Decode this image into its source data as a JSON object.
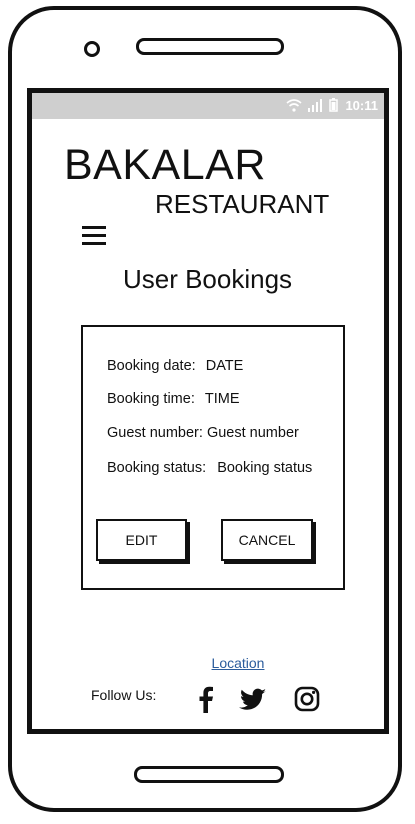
{
  "status_bar": {
    "time": "10:11",
    "icons": [
      "wifi-icon",
      "signal-icon",
      "battery-icon"
    ]
  },
  "header": {
    "brand_main": "BAKALAR",
    "brand_sub": "RESTAURANT",
    "menu_icon": "hamburger-menu-icon"
  },
  "page": {
    "title": "User Bookings"
  },
  "booking": {
    "date_label": "Booking date:",
    "date_value": "DATE",
    "time_label": "Booking time:",
    "time_value": "TIME",
    "guests_label": "Guest number:",
    "guests_value": "Guest number",
    "status_label": "Booking status:",
    "status_value": "Booking status",
    "edit_label": "EDIT",
    "cancel_label": "CANCEL"
  },
  "footer": {
    "location_link": "Location",
    "follow_label": "Follow Us:",
    "social": [
      "facebook-icon",
      "twitter-icon",
      "instagram-icon"
    ]
  }
}
